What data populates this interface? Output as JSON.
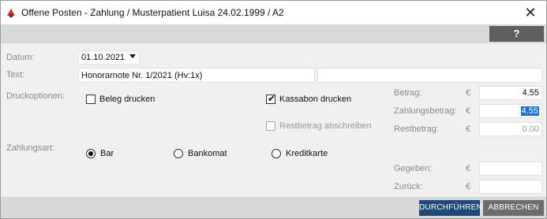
{
  "window": {
    "title": "Offene Posten - Zahlung / Musterpatient Luisa 24.02.1999 / A2",
    "close_glyph": "✕",
    "help_label": "?"
  },
  "form": {
    "datum_label": "Datum:",
    "datum_value": "01.10.2021",
    "text_label": "Text:",
    "text_value": "Honorarnote Nr. 1/2021 (Hv:1x)",
    "text_value2": "",
    "druckoptionen_label": "Druckoptionen:",
    "beleg_label": "Beleg drucken",
    "beleg_checked": false,
    "kassabon_label": "Kassabon drucken",
    "kassabon_checked": true,
    "restbetrag_abschreiben_label": "Restbetrag abschreiben",
    "restbetrag_abschreiben_checked": false,
    "zahlungsart_label": "Zahlungsart:",
    "zahlungsarten": [
      {
        "label": "Bar",
        "selected": true
      },
      {
        "label": "Bankomat",
        "selected": false
      },
      {
        "label": "Kreditkarte",
        "selected": false
      }
    ]
  },
  "amounts": {
    "currency": "€",
    "betrag_label": "Betrag:",
    "betrag_value": "4.55",
    "zahlungsbetrag_label": "Zahlungsbetrag:",
    "zahlungsbetrag_value": "4.55",
    "restbetrag_label": "Restbetrag:",
    "restbetrag_value": "0.00",
    "gegeben_label": "Gegeben:",
    "gegeben_value": "",
    "zurueck_label": "Zurück:",
    "zurueck_value": ""
  },
  "footer": {
    "primary_label": "DURCHFÜHREN",
    "secondary_label": "ABBRECHEN"
  },
  "colors": {
    "primary_button": "#1e4a7a",
    "secondary_button": "#6d6d6d",
    "selection": "#1a6fd0"
  }
}
